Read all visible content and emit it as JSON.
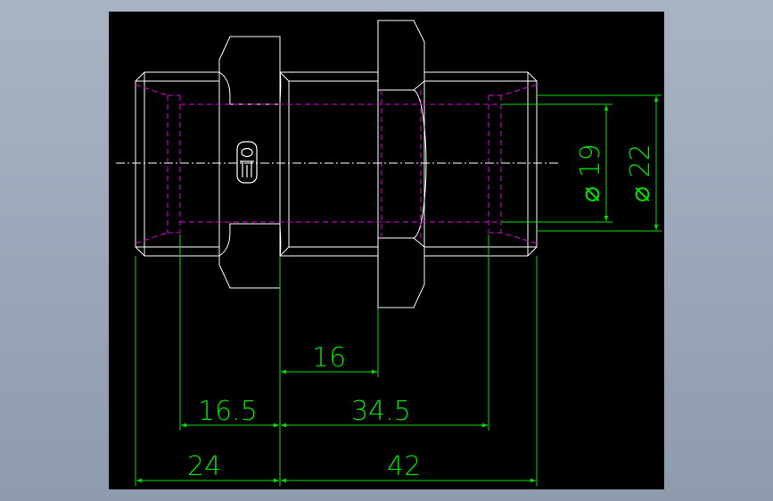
{
  "colors": {
    "background": "#000000",
    "outline": "#ffffff",
    "hidden_lines": "#e000e0",
    "dimensions": "#00e000",
    "centerline": "#ffffff"
  },
  "dimensions": {
    "d_16": "16",
    "d_16_5": "16.5",
    "d_34_5": "34.5",
    "d_24": "24",
    "d_42": "42",
    "dia_19": "⌀ 19",
    "dia_22": "⌀ 22"
  },
  "logo": {
    "icon": "manufacturer-logo-icon"
  }
}
